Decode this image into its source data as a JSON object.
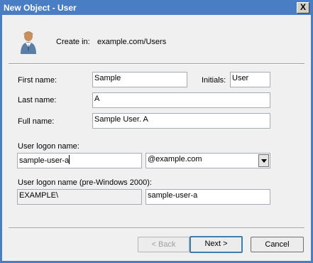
{
  "window": {
    "title": "New Object - User",
    "close_glyph": "X"
  },
  "header": {
    "create_in_label": "Create in:",
    "create_in_value": "example.com/Users",
    "icon": "user-icon"
  },
  "form": {
    "first_name_label": "First name:",
    "first_name_value": "Sample",
    "initials_label": "Initials:",
    "initials_value": "User",
    "last_name_label": "Last name:",
    "last_name_value": "A",
    "full_name_label": "Full name:",
    "full_name_value": "Sample User. A",
    "logon_name_label": "User logon name:",
    "logon_name_value": "sample-user-a",
    "domain_value": "@example.com",
    "pre2000_label": "User logon name (pre-Windows 2000):",
    "pre2000_prefix": "EXAMPLE\\",
    "pre2000_value": "sample-user-a"
  },
  "buttons": {
    "back": "< Back",
    "next": "Next >",
    "cancel": "Cancel"
  },
  "colors": {
    "titlebar": "#4a7ec4",
    "client": "#f0f0f0",
    "default_button_border": "#3c7fb1"
  }
}
